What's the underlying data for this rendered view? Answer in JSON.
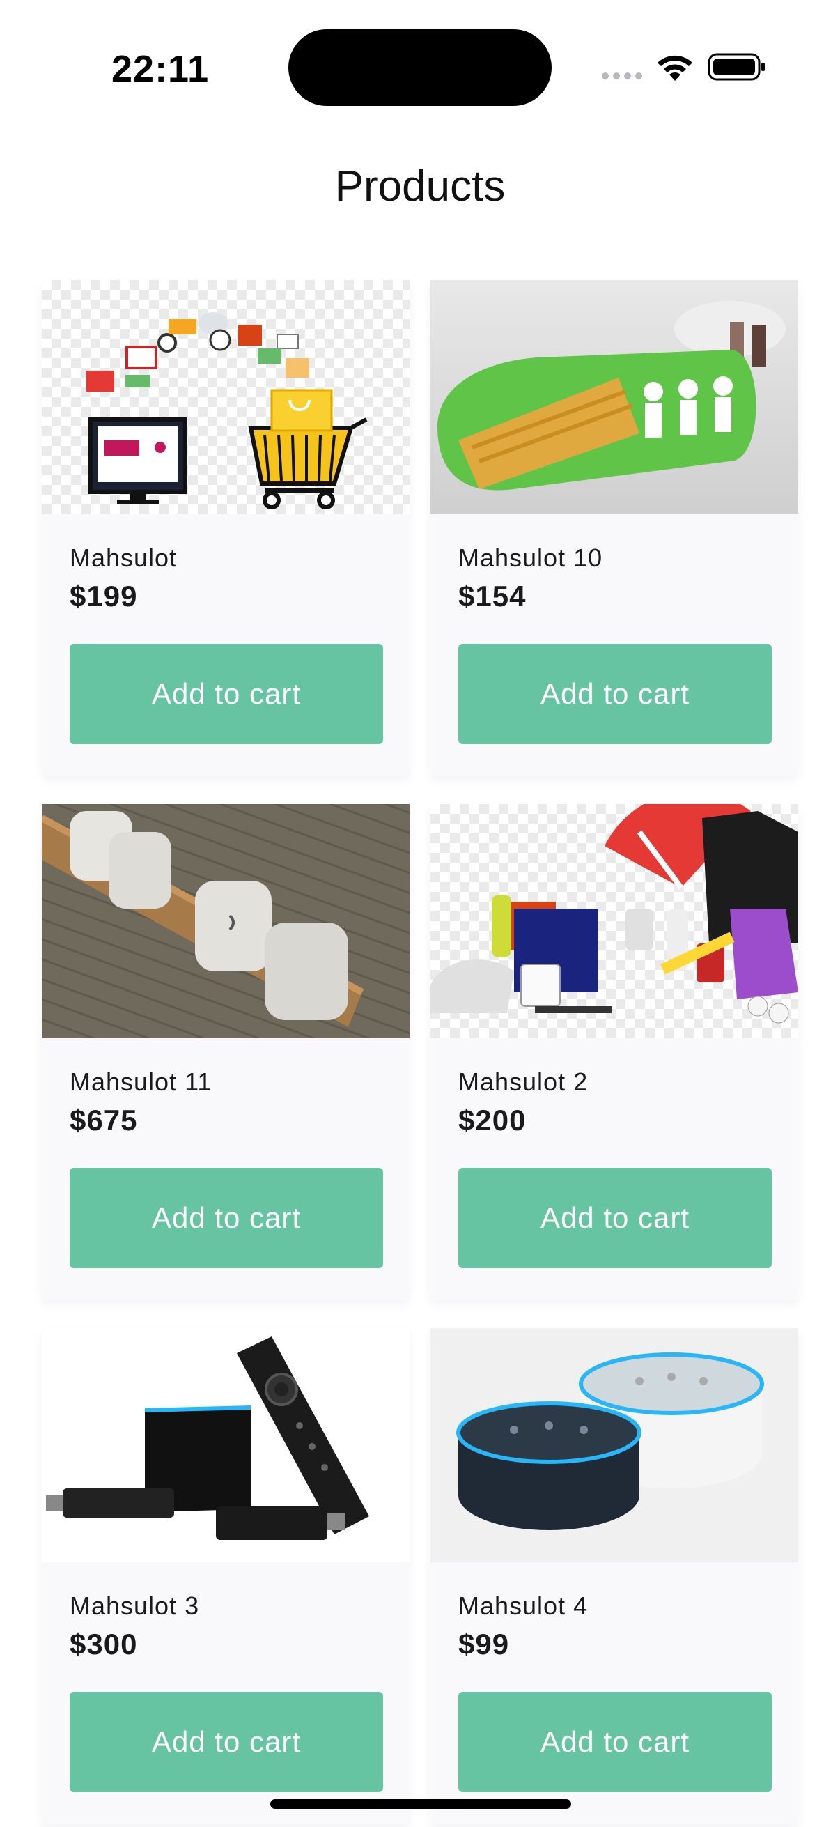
{
  "status_bar": {
    "time": "22:11"
  },
  "header": {
    "title": "Products"
  },
  "products": [
    {
      "name": "Mahsulot",
      "price": "$199",
      "button": "Add to cart",
      "image": "shopping-cart-ecommerce-image"
    },
    {
      "name": "Mahsulot 10",
      "price": "$154",
      "button": "Add to cart",
      "image": "spaghetti-holder-image"
    },
    {
      "name": "Mahsulot 11",
      "price": "$675",
      "button": "Add to cart",
      "image": "rotating-bench-image"
    },
    {
      "name": "Mahsulot 2",
      "price": "$200",
      "button": "Add to cart",
      "image": "promo-merchandise-image"
    },
    {
      "name": "Mahsulot 3",
      "price": "$300",
      "button": "Add to cart",
      "image": "fire-tv-devices-image"
    },
    {
      "name": "Mahsulot 4",
      "price": "$99",
      "button": "Add to cart",
      "image": "echo-dot-speakers-image"
    }
  ],
  "colors": {
    "accent": "#66c4a3",
    "card_bg": "#f9f9fb",
    "text": "#1a1a1a"
  }
}
